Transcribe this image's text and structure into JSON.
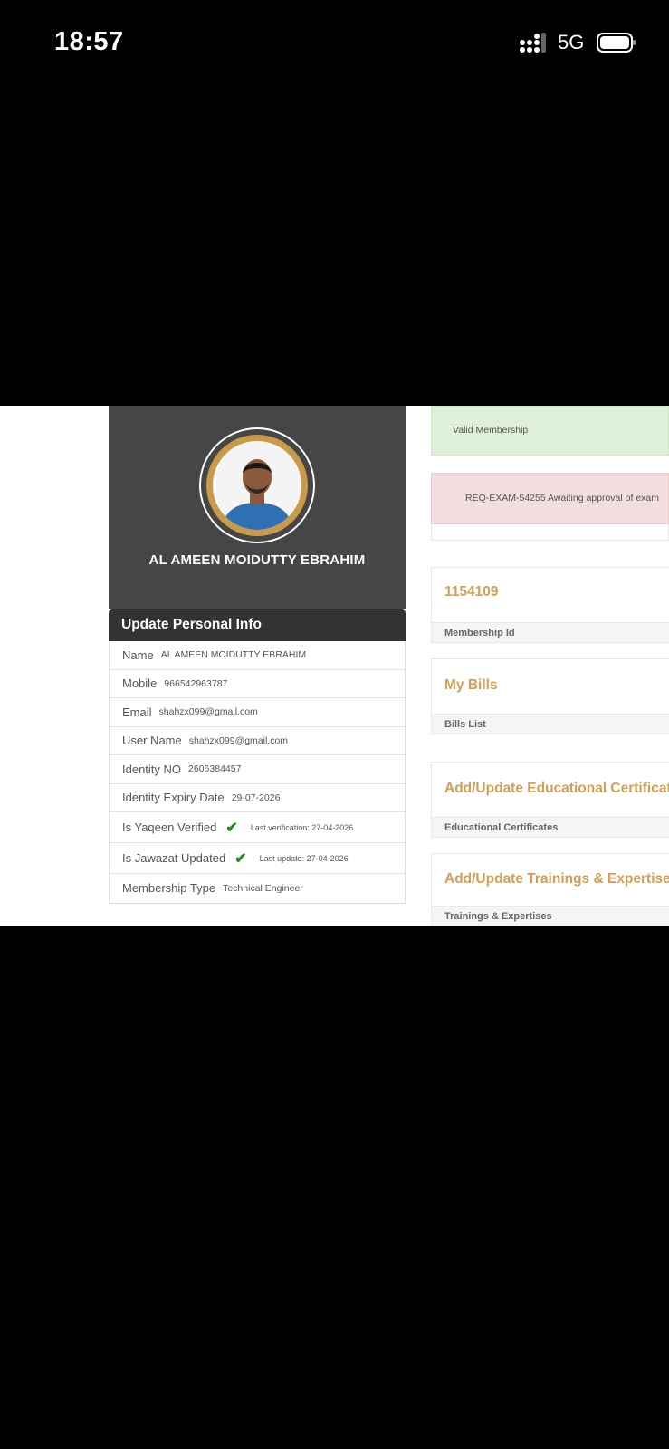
{
  "status_bar": {
    "time": "18:57",
    "network": "5G"
  },
  "profile": {
    "name": "AL AMEEN MOIDUTTY EBRAHIM"
  },
  "personal_info": {
    "header": "Update Personal Info",
    "fields": [
      {
        "label": "Name",
        "value": "AL AMEEN MOIDUTTY EBRAHIM"
      },
      {
        "label": "Mobile",
        "value": "966542963787"
      },
      {
        "label": "Email",
        "value": "shahzx099@gmail.com"
      },
      {
        "label": "User Name",
        "value": "shahzx099@gmail.com"
      },
      {
        "label": "Identity NO",
        "value": "2606384457"
      },
      {
        "label": "Identity Expiry Date",
        "value": "29-07-2026"
      },
      {
        "label": "Is Yaqeen Verified",
        "value": "Last verification: 27-04-2026",
        "check": true
      },
      {
        "label": "Is Jawazat Updated",
        "value": "Last update: 27-04-2026",
        "check": true
      },
      {
        "label": "Membership Type",
        "value": "Technical Engineer"
      }
    ]
  },
  "alerts": {
    "success": "Valid Membership",
    "danger": "REQ-EXAM-54255 Awaiting approval of exam"
  },
  "panels": {
    "membership": {
      "title": "1154109",
      "footer": "Membership Id"
    },
    "bills": {
      "title": "My Bills",
      "footer": "Bills List"
    },
    "certificates": {
      "title": "Add/Update Educational Certificates",
      "footer": "Educational Certificates"
    },
    "trainings": {
      "title": "Add/Update Trainings & Expertises",
      "footer": "Trainings & Expertises"
    }
  },
  "colors": {
    "accent_gold": "#d39f55",
    "dark_header": "#333333",
    "profile_bg": "#464646",
    "success_bg": "#dff0d8",
    "danger_bg": "#f2dede",
    "check_green": "#1e8a1e"
  }
}
